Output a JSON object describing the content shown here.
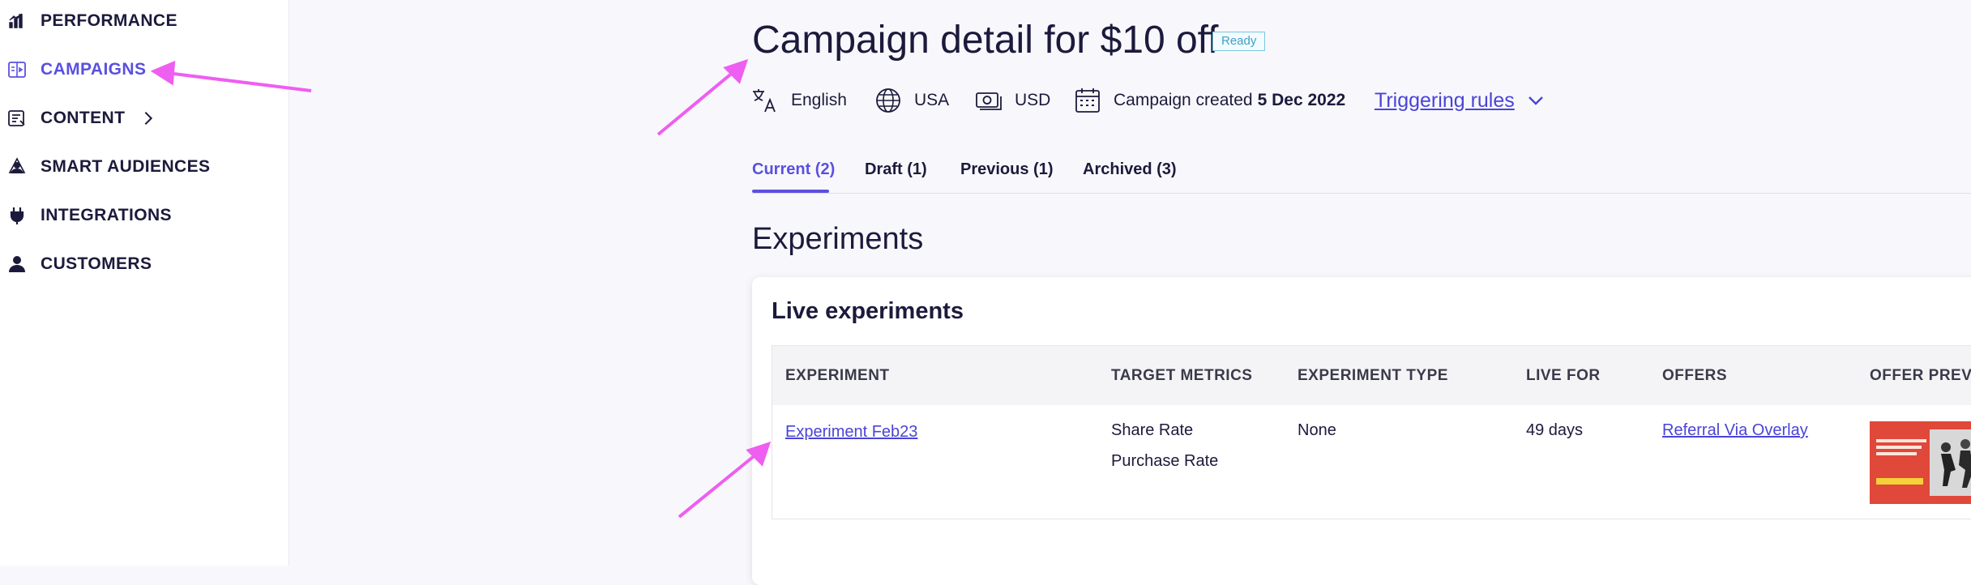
{
  "sidebar": {
    "items": [
      {
        "label": "PERFORMANCE",
        "icon": "chart-bars-icon"
      },
      {
        "label": "CAMPAIGNS",
        "icon": "campaigns-icon",
        "active": true
      },
      {
        "label": "CONTENT",
        "icon": "content-icon",
        "has_chevron": true
      },
      {
        "label": "SMART AUDIENCES",
        "icon": "audiences-icon"
      },
      {
        "label": "INTEGRATIONS",
        "icon": "plug-icon"
      },
      {
        "label": "CUSTOMERS",
        "icon": "person-icon"
      }
    ]
  },
  "header": {
    "title": "Campaign detail for $10 off",
    "status_badge": "Ready",
    "language": "English",
    "country": "USA",
    "currency": "USD",
    "created_label": "Campaign created",
    "created_date": "5 Dec 2022",
    "triggering_rules": "Triggering rules"
  },
  "tabs": [
    {
      "label": "Current (2)",
      "active": true
    },
    {
      "label": "Draft (1)"
    },
    {
      "label": "Previous (1)"
    },
    {
      "label": "Archived (3)"
    }
  ],
  "experiments": {
    "section_title": "Experiments",
    "card_title": "Live experiments",
    "columns": [
      "EXPERIMENT",
      "TARGET METRICS",
      "EXPERIMENT TYPE",
      "LIVE FOR",
      "OFFERS",
      "OFFER PREVIEW"
    ],
    "rows": [
      {
        "experiment": "Experiment Feb23",
        "target_metrics": [
          "Share Rate",
          "Purchase Rate"
        ],
        "experiment_type": "None",
        "live_for": "49 days",
        "offers": "Referral Via Overlay"
      }
    ]
  },
  "colors": {
    "accent": "#5a50e0",
    "link": "#4a44d6",
    "annotation_arrow": "#ee5ef0",
    "badge": "#3ea0c8",
    "preview_bg": "#e0483a"
  }
}
